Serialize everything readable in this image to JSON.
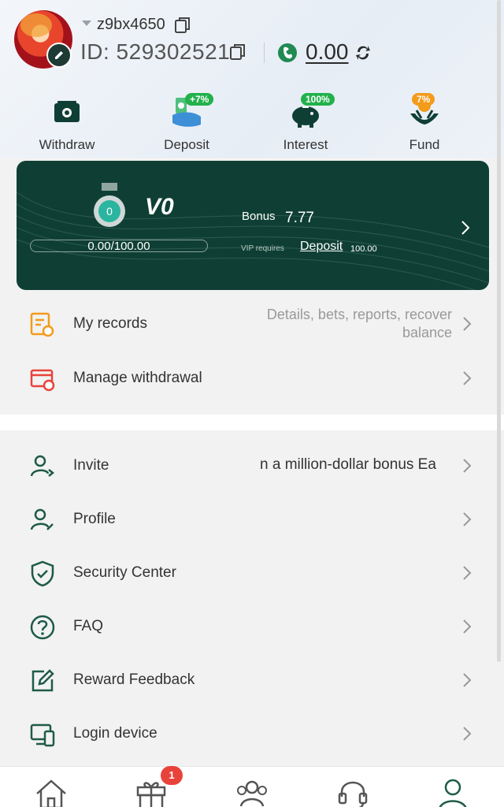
{
  "user": {
    "username": "z9bx4650",
    "id": "ID: 529302521",
    "balance": "0.00"
  },
  "quick_actions": [
    {
      "label": "Withdraw",
      "icon": "withdraw-icon",
      "badge": ""
    },
    {
      "label": "Deposit",
      "icon": "deposit-icon",
      "badge": "+7%"
    },
    {
      "label": "Interest",
      "icon": "interest-icon",
      "badge": "100%"
    },
    {
      "label": "Fund",
      "icon": "fund-icon",
      "badge": "7%"
    }
  ],
  "vip": {
    "level": "V0",
    "medal_number": "0",
    "progress_text": "0.00/100.00",
    "progress_fraction": 0,
    "bonus_label": "Bonus",
    "bonus_value": "7.77",
    "requires_label": "VIP requires",
    "deposit_label": "Deposit",
    "deposit_amount": "100.00"
  },
  "menu_top": [
    {
      "label": "My records",
      "desc_line1": "Details, bets, reports, recover",
      "desc_line2": "balance",
      "icon": "records-icon"
    },
    {
      "label": "Manage withdrawal",
      "icon": "withdrawal-card-icon"
    }
  ],
  "menu_bottom": [
    {
      "label": "Invite",
      "marquee": "n a million-dollar bonus  Ea",
      "icon": "invite-icon"
    },
    {
      "label": "Profile",
      "icon": "profile-icon"
    },
    {
      "label": "Security Center",
      "icon": "shield-icon"
    },
    {
      "label": "FAQ",
      "icon": "question-icon"
    },
    {
      "label": "Reward Feedback",
      "icon": "feedback-icon"
    },
    {
      "label": "Login device",
      "icon": "device-icon"
    }
  ],
  "bottom_nav": {
    "items": [
      "home-icon",
      "gift-icon",
      "agents-icon",
      "support-icon",
      "account-icon"
    ],
    "gift_badge": "1"
  },
  "colors": {
    "brand_dark": "#0f3f34",
    "accent_green": "#1e5a48",
    "badge_red": "#e8433b",
    "pill_green": "#22b14c",
    "pill_orange": "#f39b1b"
  }
}
